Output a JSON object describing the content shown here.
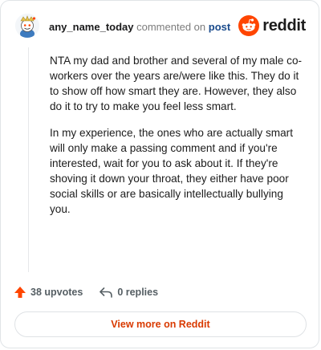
{
  "header": {
    "username": "any_name_today",
    "commented_text": "commented on",
    "post_link": "post",
    "brand": "reddit"
  },
  "comment": {
    "paragraphs": [
      "NTA my dad and brother and several of my male co-workers over the years are/were like this. They do it to show off how smart they are. However, they also do it to try to make you feel less smart.",
      "In my experience, the ones who are actually smart will only make a passing comment and if you're interested, wait for you to ask about it. If they're shoving it down your throat, they either have poor social skills or are basically intellectually bullying you."
    ]
  },
  "actions": {
    "upvotes_label": "38 upvotes",
    "replies_label": "0 replies"
  },
  "footer": {
    "view_more_label": "View more on Reddit"
  },
  "colors": {
    "brand_orange": "#ff4500",
    "link_blue": "#1a4b8c",
    "view_more_text": "#d93a00"
  },
  "icons": {
    "avatar": "snoo-avatar",
    "logo": "reddit-logo-icon",
    "upvote": "upvote-arrow-icon",
    "reply": "reply-arrow-icon"
  }
}
